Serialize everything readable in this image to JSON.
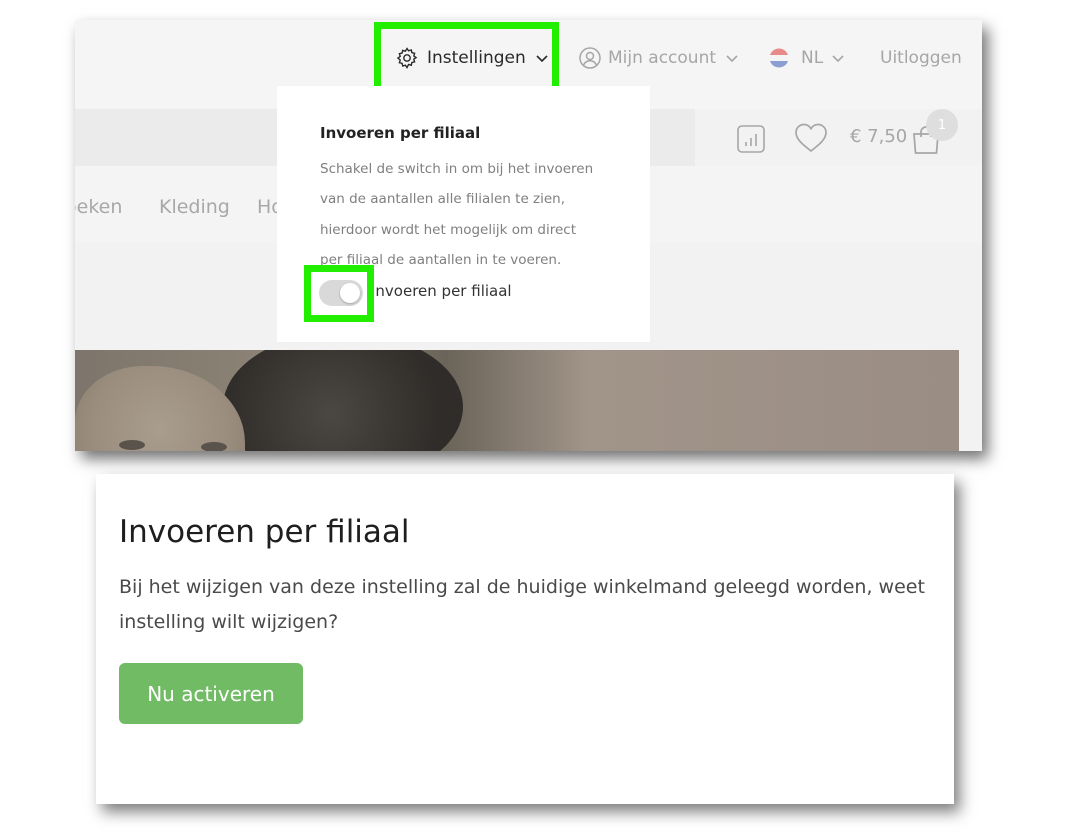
{
  "header": {
    "settings_label": "Instellingen",
    "account_label": "Mijn account",
    "language_label": "NL",
    "logout_label": "Uitloggen"
  },
  "categories": [
    "oeken",
    "Kleding",
    "Ho"
  ],
  "cart": {
    "total": "€ 7,50",
    "count": "1"
  },
  "dropdown": {
    "title": "Invoeren per filiaal",
    "text_lines": [
      "Schakel de switch in om bij het invoeren",
      "van de aantallen alle filialen te zien,",
      "hierdoor wordt het mogelijk om direct",
      "per filiaal de aantallen in te voeren."
    ],
    "toggle_label": "Invoeren per filiaal",
    "toggle_state": "off"
  },
  "modal": {
    "title": "Invoeren per filiaal",
    "body_lines": [
      "Bij het wijzigen van deze instelling zal de huidige winkelmand geleegd worden, weet",
      "instelling wilt wijzigen?"
    ],
    "button_label": "Nu activeren"
  },
  "colors": {
    "highlight": "#22ee00",
    "primary_button": "#72bb65"
  },
  "icons": [
    "gear-icon",
    "user-circle-icon",
    "chevron-down-icon",
    "flag-nl-icon",
    "compare-chart-icon",
    "heart-icon",
    "shopping-bag-icon"
  ]
}
